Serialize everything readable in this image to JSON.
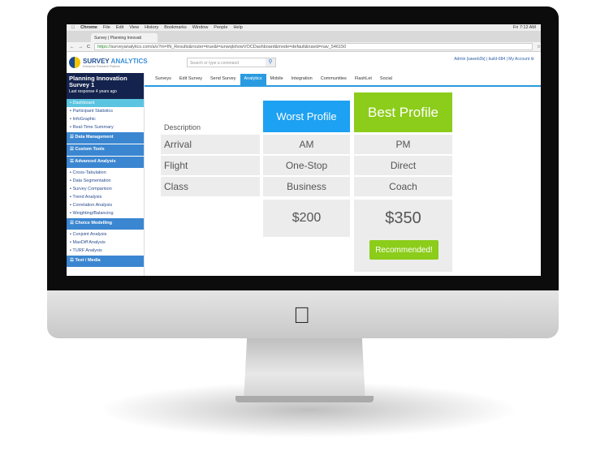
{
  "browser": {
    "menu": [
      "Chrome",
      "File",
      "Edit",
      "View",
      "History",
      "Bookmarks",
      "Window",
      "People",
      "Help"
    ],
    "clock": "Fri 7:12 AM",
    "tab_title": "Survey | Planning Innovati",
    "url_scheme": "https://",
    "url_rest": "surveyanalytics.com/a/s?m=IN_Results&router=true&l=iunwqlshowVOCDashboard&mode=default&navid=nav_546150"
  },
  "app": {
    "logo_name": "SURVEY",
    "logo_name2": "ANALYTICS",
    "logo_tagline": "Enterprise Research Platform",
    "search_placeholder": "Search or type a command",
    "account": "Admin [saweb2b] | build-684 | My Account ⚙"
  },
  "project": {
    "name": "Planning Innovation Survey 1",
    "last": "Last response 4 years ago"
  },
  "sidebar": {
    "items": [
      {
        "type": "item",
        "label": "Dashboard",
        "active": true
      },
      {
        "type": "item",
        "label": "Participant Statistics"
      },
      {
        "type": "item",
        "label": "InfoGraphic"
      },
      {
        "type": "item",
        "label": "Real-Time Summary"
      },
      {
        "type": "section",
        "label": "Data Management"
      },
      {
        "type": "section",
        "label": "Custom Tools"
      },
      {
        "type": "section",
        "label": "Advanced Analysis"
      },
      {
        "type": "item",
        "label": "Cross-Tabulation"
      },
      {
        "type": "item",
        "label": "Data Segmentation"
      },
      {
        "type": "item",
        "label": "Survey Comparison"
      },
      {
        "type": "item",
        "label": "Trend Analysis"
      },
      {
        "type": "item",
        "label": "Correlation Analysis"
      },
      {
        "type": "item",
        "label": "Weighting/Balancing"
      },
      {
        "type": "section",
        "label": "Choice Modelling"
      },
      {
        "type": "item",
        "label": "Conjoint Analysis"
      },
      {
        "type": "item",
        "label": "MaxDiff Analysis"
      },
      {
        "type": "item",
        "label": "TURF Analysis"
      },
      {
        "type": "section",
        "label": "Text / Media"
      }
    ]
  },
  "nav": {
    "tabs": [
      "Surveys",
      "Edit Survey",
      "Send Survey",
      "Analytics",
      "Mobile",
      "Integration",
      "Communities",
      "FlashLet",
      "Social"
    ],
    "active": "Analytics"
  },
  "profiles": {
    "description_label": "Description",
    "worst_label": "Worst Profile",
    "best_label": "Best Profile",
    "worst_color": "#1da1f2",
    "best_color": "#8ccc1a",
    "rows": [
      {
        "attr": "Arrival",
        "worst": "AM",
        "best": "PM"
      },
      {
        "attr": "Flight",
        "worst": "One-Stop",
        "best": "Direct"
      },
      {
        "attr": "Class",
        "worst": "Business",
        "best": "Coach"
      }
    ],
    "worst_price": "$200",
    "best_price": "$350",
    "recommended_label": "Recommended!"
  }
}
